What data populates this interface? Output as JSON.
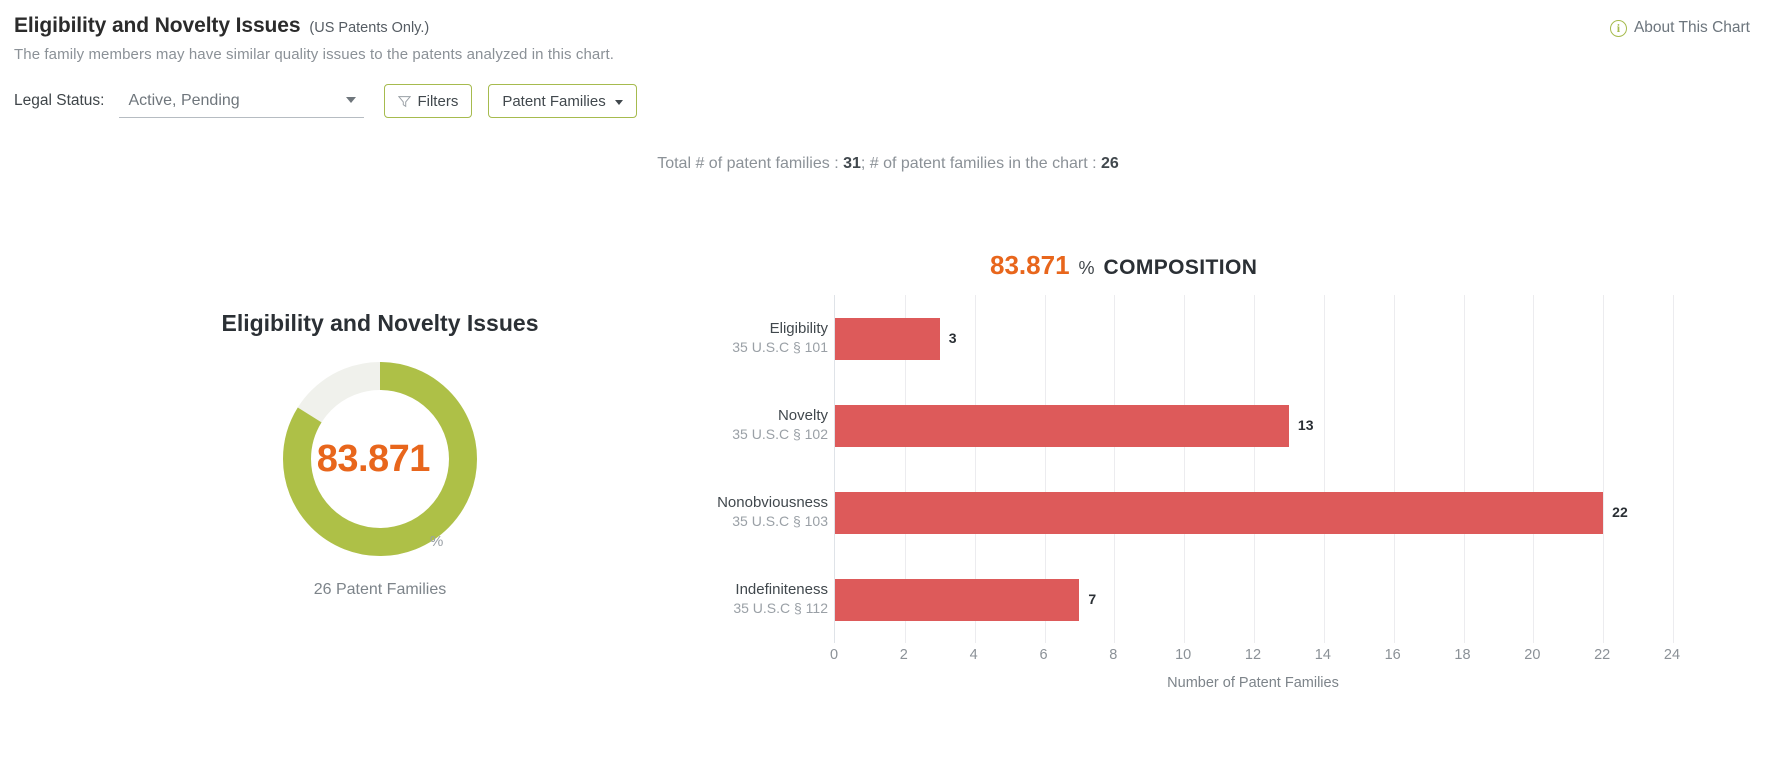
{
  "header": {
    "title": "Eligibility and Novelty Issues",
    "title_note": "(US Patents Only.)",
    "description": "The family members may have similar quality issues to the patents analyzed in this chart.",
    "about_label": "About This Chart",
    "about_icon": "info-circle-icon"
  },
  "controls": {
    "legal_status_label": "Legal Status:",
    "legal_status_value": "Active, Pending",
    "filters_label": "Filters",
    "filters_icon": "funnel-icon",
    "patent_families_label": "Patent Families",
    "dropdown_icon": "chevron-down-icon"
  },
  "totals": {
    "prefix": "Total # of patent families : ",
    "total": "31",
    "middle": "; # of patent families in the chart : ",
    "in_chart": "26"
  },
  "donut": {
    "title": "Eligibility and Novelty Issues",
    "percent": "83.871",
    "percent_symbol": "%",
    "caption": "26 Patent Families",
    "fill_color": "#aec047",
    "track_color": "#f0f1ec",
    "value_color": "#e8661c"
  },
  "composition": {
    "percent": "83.871",
    "percent_symbol": "%",
    "label": "COMPOSITION"
  },
  "chart_data": {
    "type": "bar",
    "orientation": "horizontal",
    "title": "Eligibility and Novelty Issues",
    "xlabel": "Number of Patent Families",
    "ylabel": "",
    "xlim": [
      0,
      24
    ],
    "xticks": [
      "0",
      "2",
      "4",
      "6",
      "8",
      "10",
      "12",
      "14",
      "16",
      "18",
      "20",
      "22",
      "24"
    ],
    "grid": true,
    "legend": "none",
    "bar_color": "#dd5a5a",
    "categories": [
      {
        "name": "Eligibility",
        "statute": "35 U.S.C § 101"
      },
      {
        "name": "Novelty",
        "statute": "35 U.S.C § 102"
      },
      {
        "name": "Nonobviousness",
        "statute": "35 U.S.C § 103"
      },
      {
        "name": "Indefiniteness",
        "statute": "35 U.S.C § 112"
      }
    ],
    "values": [
      3,
      13,
      22,
      7
    ],
    "value_labels": [
      "3",
      "13",
      "22",
      "7"
    ]
  }
}
